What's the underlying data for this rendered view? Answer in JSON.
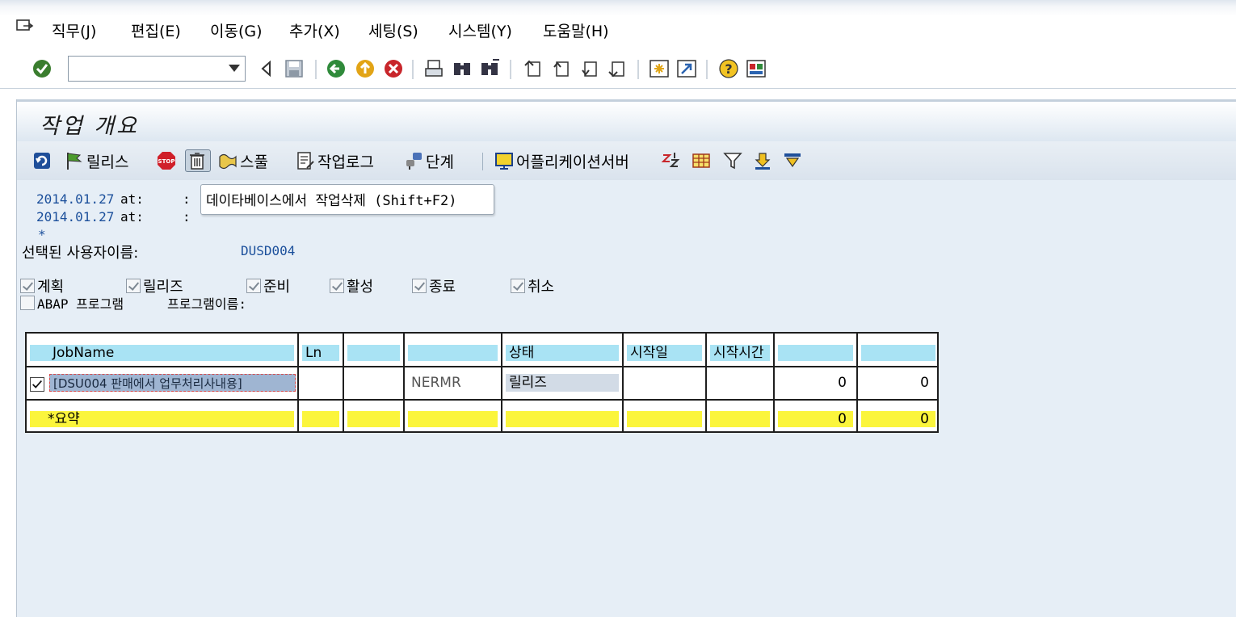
{
  "menu": {
    "items": [
      "직무(J)",
      "편집(E)",
      "이동(G)",
      "추가(X)",
      "세팅(S)",
      "시스템(Y)",
      "도움말(H)"
    ]
  },
  "toolbar": {
    "command_field_value": "",
    "icons": [
      "enter-icon",
      "back-icon",
      "save-icon",
      "green-back-icon",
      "exit-icon",
      "cancel-icon",
      "print-icon",
      "find-icon",
      "find-next-icon",
      "first-page-icon",
      "prev-page-icon",
      "next-page-icon",
      "last-page-icon",
      "create-session-icon",
      "shortcut-icon",
      "help-icon",
      "layout-icon"
    ]
  },
  "page": {
    "title": "작업 개요"
  },
  "app_toolbar": {
    "release_label": "릴리스",
    "spool_label": "스풀",
    "job_log_label": "작업로그",
    "step_label": "단계",
    "app_server_label": "어플리케이션서버"
  },
  "info": {
    "date1": "2014.01.27",
    "date2": "2014.01.27",
    "at_label": "at:",
    "colon1": ":",
    "colon2": ":",
    "asterisk": "*",
    "user_label": "선택된 사용자이름:",
    "user_value": "DUSD004"
  },
  "tooltip": {
    "text": "데이타베이스에서 작업삭제  (Shift+F2)"
  },
  "filters": {
    "planned": "계획",
    "released": "릴리즈",
    "ready": "준비",
    "active": "활성",
    "finished": "종료",
    "cancelled": "취소",
    "abap_program": "ABAP 프로그램",
    "program_name_label": "프로그램이름:"
  },
  "table": {
    "headers": [
      "JobName",
      "Ln",
      "",
      "",
      "상태",
      "시작일",
      "시작시간",
      "",
      ""
    ],
    "row": {
      "job_name": "[DSU004 판매에서 업무처리사내용]",
      "ln": "",
      "col3": "",
      "col4": "NERMR",
      "status": "릴리즈",
      "start_date": "",
      "start_time": "",
      "num1": "0",
      "num2": "0"
    },
    "summary": {
      "label": "*요약",
      "num1": "0",
      "num2": "0"
    }
  }
}
